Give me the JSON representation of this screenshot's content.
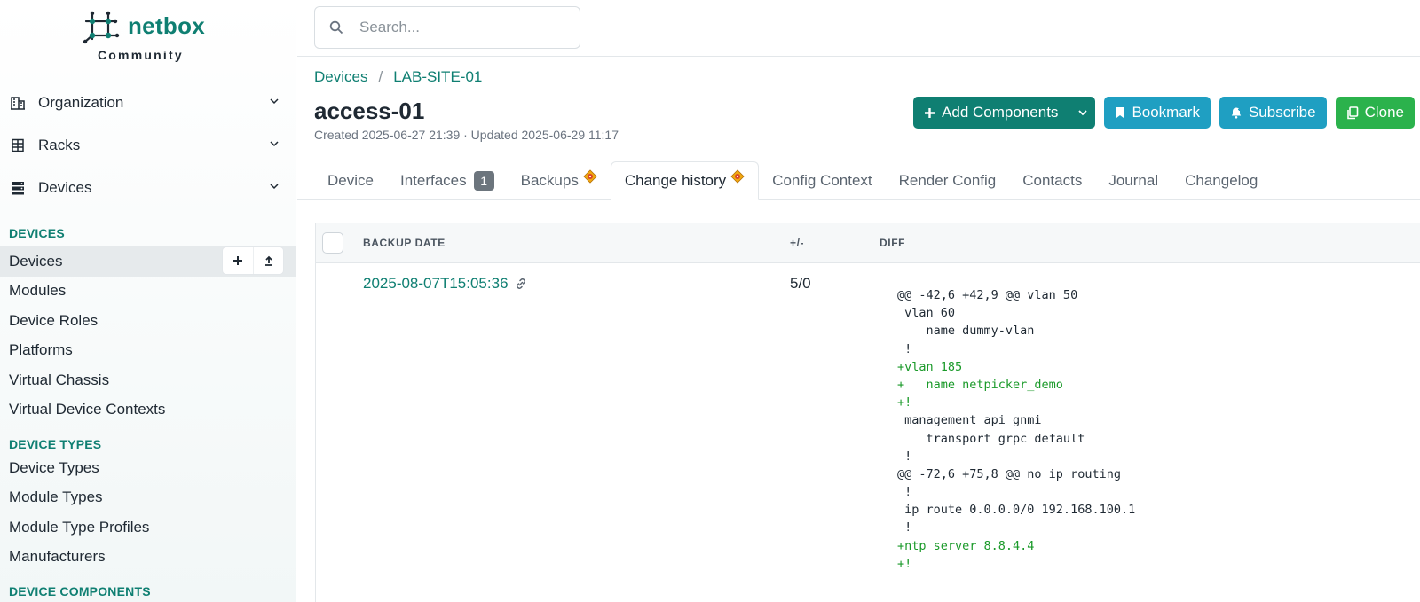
{
  "brand": {
    "name": "netbox",
    "sub": "Community"
  },
  "search": {
    "placeholder": "Search..."
  },
  "sidebar": {
    "groups": [
      {
        "label": "Organization",
        "icon": "domain-icon"
      },
      {
        "label": "Racks",
        "icon": "rack-icon"
      },
      {
        "label": "Devices",
        "icon": "server-icon"
      }
    ],
    "sections": [
      {
        "title": "DEVICES",
        "items": [
          "Devices",
          "Modules",
          "Device Roles",
          "Platforms",
          "Virtual Chassis",
          "Virtual Device Contexts"
        ]
      },
      {
        "title": "DEVICE TYPES",
        "items": [
          "Device Types",
          "Module Types",
          "Module Type Profiles",
          "Manufacturers"
        ]
      },
      {
        "title": "DEVICE COMPONENTS",
        "items": []
      }
    ],
    "active_item": "Devices"
  },
  "breadcrumb": {
    "items": [
      "Devices",
      "LAB-SITE-01"
    ],
    "separator": "/"
  },
  "page": {
    "title": "access-01",
    "meta": "Created 2025-06-27 21:39 · Updated 2025-06-29 11:17"
  },
  "actions": {
    "add_components": "Add Components",
    "bookmark": "Bookmark",
    "subscribe": "Subscribe",
    "clone": "Clone"
  },
  "tabs": [
    {
      "label": "Device"
    },
    {
      "label": "Interfaces",
      "badge": "1"
    },
    {
      "label": "Backups",
      "icon": "warning-icon"
    },
    {
      "label": "Change history",
      "icon": "warning-icon",
      "active": true
    },
    {
      "label": "Config Context"
    },
    {
      "label": "Render Config"
    },
    {
      "label": "Contacts"
    },
    {
      "label": "Journal"
    },
    {
      "label": "Changelog"
    }
  ],
  "table": {
    "headers": {
      "date": "BACKUP DATE",
      "delta": "+/-",
      "diff": "DIFF"
    },
    "rows": [
      {
        "date": "2025-08-07T15:05:36",
        "delta": "5/0",
        "diff": [
          {
            "text": "@@ -42,6 +42,9 @@ vlan 50",
            "type": "ctx"
          },
          {
            "text": " vlan 60",
            "type": "ctx"
          },
          {
            "text": "    name dummy-vlan",
            "type": "ctx"
          },
          {
            "text": " !",
            "type": "ctx"
          },
          {
            "text": "+vlan 185",
            "type": "add"
          },
          {
            "text": "+   name netpicker_demo",
            "type": "add"
          },
          {
            "text": "+!",
            "type": "add"
          },
          {
            "text": " management api gnmi",
            "type": "ctx"
          },
          {
            "text": "    transport grpc default",
            "type": "ctx"
          },
          {
            "text": " !",
            "type": "ctx"
          },
          {
            "text": "@@ -72,6 +75,8 @@ no ip routing",
            "type": "ctx"
          },
          {
            "text": " !",
            "type": "ctx"
          },
          {
            "text": " ip route 0.0.0.0/0 192.168.100.1",
            "type": "ctx"
          },
          {
            "text": " !",
            "type": "ctx"
          },
          {
            "text": "+ntp server 8.8.4.4",
            "type": "add"
          },
          {
            "text": "+!",
            "type": "add"
          }
        ]
      }
    ]
  },
  "colors": {
    "accent": "#0f7f72",
    "cyan": "#1f9fc2",
    "green": "#2bb24c",
    "diff_add": "#1b9a2a"
  }
}
